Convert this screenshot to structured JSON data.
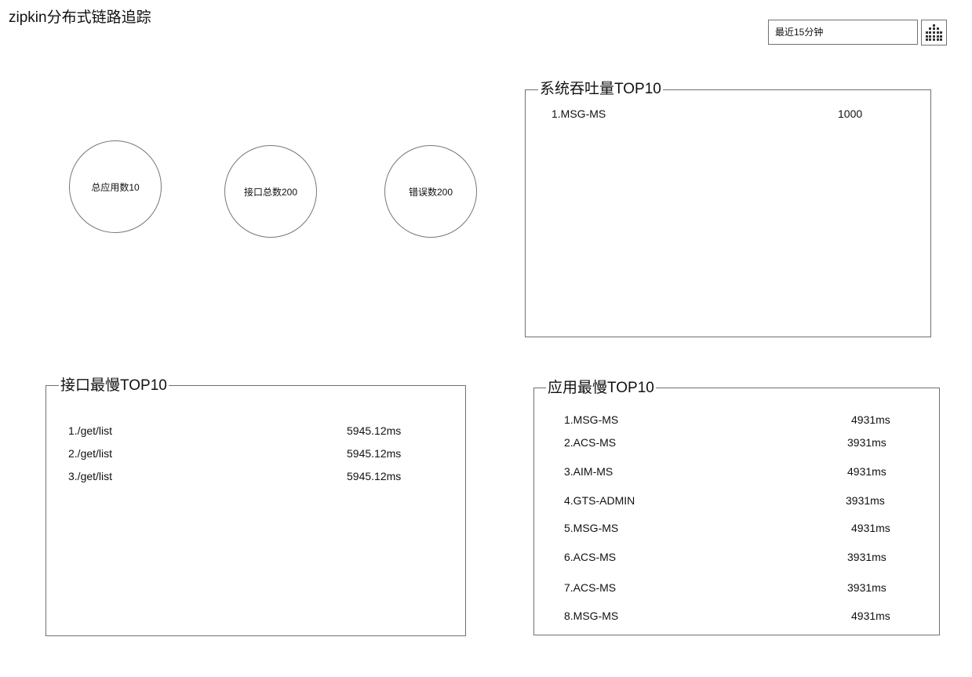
{
  "app": {
    "title": "zipkin分布式链路追踪"
  },
  "time_range": {
    "selected": "最近15分钟"
  },
  "stats": {
    "apps": "总应用数10",
    "apis": "接口总数200",
    "errors": "错误数200"
  },
  "throughput": {
    "title": "系统吞吐量TOP10",
    "items": [
      {
        "name": "1.MSG-MS",
        "value": "1000"
      }
    ]
  },
  "slow_api": {
    "title": "接口最慢TOP10",
    "items": [
      {
        "name": "1./get/list",
        "value": "5945.12ms"
      },
      {
        "name": "2./get/list",
        "value": "5945.12ms"
      },
      {
        "name": "3./get/list",
        "value": "5945.12ms"
      }
    ]
  },
  "slow_app": {
    "title": "应用最慢TOP10",
    "items": [
      {
        "name": "1.MSG-MS",
        "value": "4931ms"
      },
      {
        "name": "2.ACS-MS",
        "value": "3931ms"
      },
      {
        "name": "3.AIM-MS",
        "value": "4931ms"
      },
      {
        "name": "4.GTS-ADMIN",
        "value": "3931ms"
      },
      {
        "name": "5.MSG-MS",
        "value": "4931ms"
      },
      {
        "name": "6.ACS-MS",
        "value": "3931ms"
      },
      {
        "name": "7.ACS-MS",
        "value": "3931ms"
      },
      {
        "name": "8.MSG-MS",
        "value": "4931ms"
      }
    ]
  }
}
